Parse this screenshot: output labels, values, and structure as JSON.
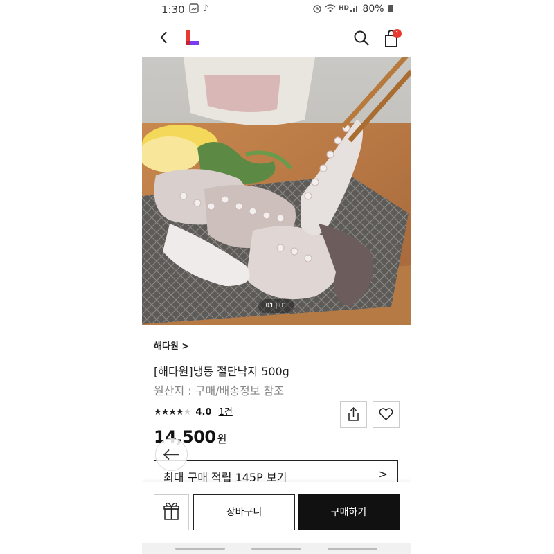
{
  "status_bar": {
    "time": "1:30",
    "battery": "80%"
  },
  "header": {
    "badge_count": "1"
  },
  "gallery": {
    "current": "01",
    "separator": "|",
    "total": "01"
  },
  "product": {
    "brand_label": "해다원 >",
    "title": "[해다원]냉동 절단낙지 500g",
    "origin": "원산지 : 구매/배송정보 참조",
    "rating_stars": "★★★★",
    "rating_star_off": "★",
    "rating_value": "4.0",
    "review_count": "1건",
    "price": "14,500",
    "currency": "원"
  },
  "points": {
    "text": "최대 구매 적립 145P 보기",
    "chevron": ">"
  },
  "actions": {
    "cart_label": "장바구니",
    "buy_label": "구매하기"
  },
  "colors": {
    "accent_red": "#e8382f",
    "logo_purple": "#7a3cf0",
    "buy_bg": "#111111"
  }
}
